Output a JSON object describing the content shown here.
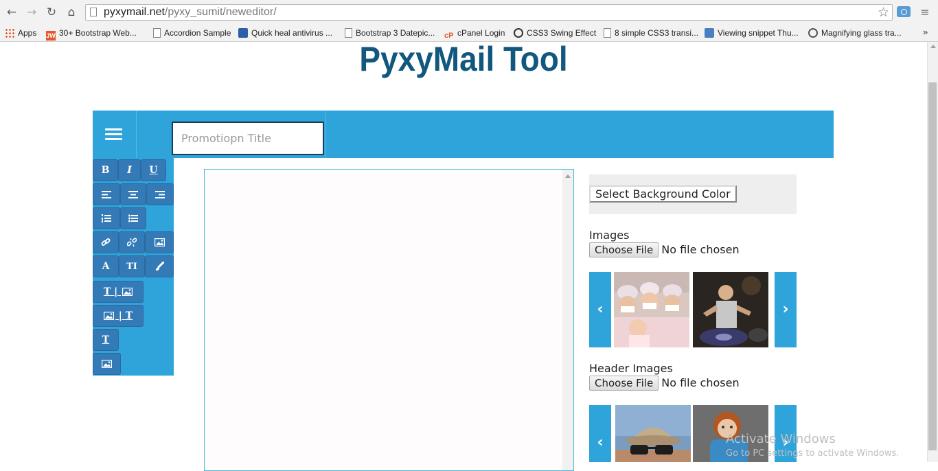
{
  "browser": {
    "url_host": "pyxymail.net",
    "url_path": "/pyxy_sumit/neweditor/",
    "bookmarks": [
      {
        "label": "Apps",
        "icon": "apps-grid-icon"
      },
      {
        "label": "30+ Bootstrap Web...",
        "icon": "jw-icon"
      },
      {
        "label": "Accordion Sample",
        "icon": "page-icon"
      },
      {
        "label": "Quick heal antivirus ...",
        "icon": "quickheal-icon"
      },
      {
        "label": "Bootstrap 3 Datepic...",
        "icon": "page-icon"
      },
      {
        "label": "cPanel Login",
        "icon": "cpanel-icon"
      },
      {
        "label": "CSS3 Swing Effect",
        "icon": "codepen-icon"
      },
      {
        "label": "8 simple CSS3 transi...",
        "icon": "page-icon"
      },
      {
        "label": "Viewing snippet Thu...",
        "icon": "bootsnipp-icon"
      },
      {
        "label": "Magnifying glass tra...",
        "icon": "wordpress-icon"
      }
    ],
    "more_bookmarks": "»"
  },
  "page": {
    "title": "PyxyMail Tool"
  },
  "header": {
    "title_placeholder": "Promotiopn Title"
  },
  "toolbar": {
    "bold": "B",
    "italic": "I",
    "underline": "U",
    "font_color": "A",
    "text_size": "TI",
    "text_image_layout": "T | ",
    "image_text_layout": " | T",
    "text_only": "T"
  },
  "right_panel": {
    "bg_color_button": "Select Background Color",
    "images_label": "Images",
    "header_images_label": "Header Images",
    "choose_file": "Choose File",
    "no_file": "No file chosen",
    "prev": "‹",
    "next": "›"
  },
  "os": {
    "activate_title": "Activate Windows",
    "activate_sub": "Go to PC settings to activate Windows."
  }
}
